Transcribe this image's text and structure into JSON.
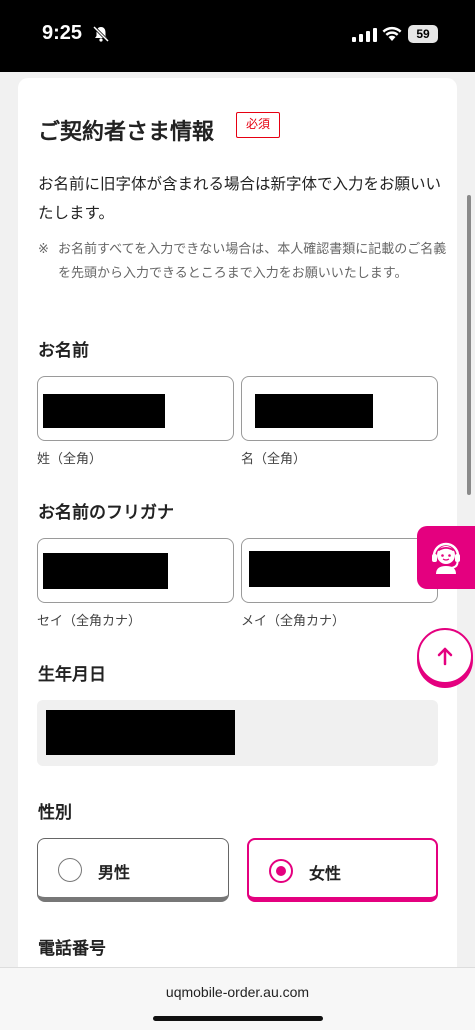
{
  "status_bar": {
    "time": "9:25",
    "battery": "59",
    "icons": [
      "bell-slash-icon",
      "signal-icon",
      "wifi-icon",
      "battery-icon"
    ]
  },
  "form": {
    "section_title": "ご契約者さま情報",
    "required_badge": "必須",
    "intro": "お名前に旧字体が含まれる場合は新字体で入力をお願いいたします。",
    "note_mark": "※",
    "note_text": "お名前すべてを入力できない場合は、本人確認書類に記載のご名義を先頭から入力できるところまで入力をお願いいたします。",
    "name": {
      "label": "お名前",
      "last_sub": "姓（全角）",
      "first_sub": "名（全角）"
    },
    "kana": {
      "label": "お名前のフリガナ",
      "last_sub": "セイ（全角カナ）",
      "first_sub": "メイ（全角カナ）"
    },
    "birthdate": {
      "label": "生年月日"
    },
    "gender": {
      "label": "性別",
      "options": [
        {
          "label": "男性",
          "selected": false
        },
        {
          "label": "女性",
          "selected": true
        }
      ]
    },
    "phone": {
      "label": "電話番号"
    }
  },
  "browser": {
    "url": "uqmobile-order.au.com"
  },
  "colors": {
    "accent": "#e4007f",
    "required": "#e60012",
    "redaction": "#000000"
  },
  "floating": {
    "support_icon": "headset-operator-icon",
    "scroll_top_icon": "arrow-up-icon"
  }
}
